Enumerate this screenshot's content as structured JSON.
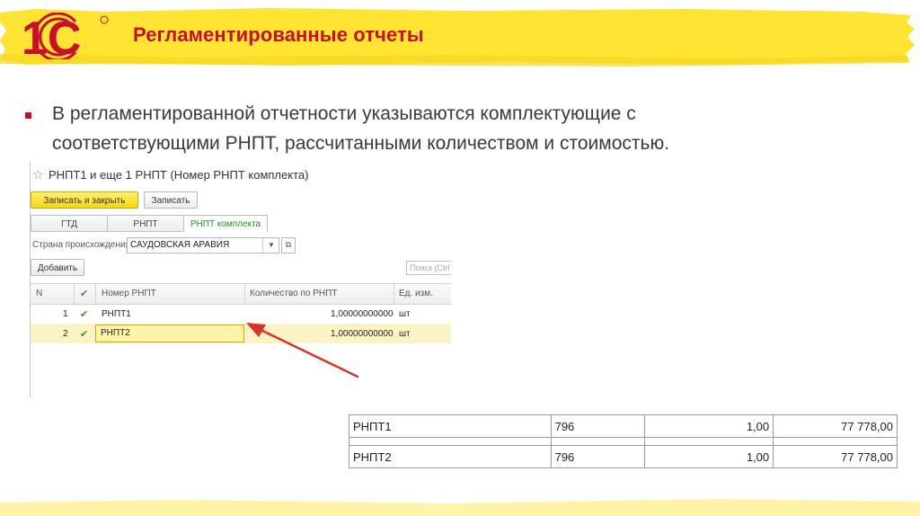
{
  "header": {
    "logo_text": "1С",
    "title": "Регламентированные отчеты",
    "colors": {
      "brand_red": "#c8102e",
      "band_yellow": "#ffe433"
    }
  },
  "bullet": {
    "line1": "В регламентированной отчетности указываются комплектующие с",
    "line2": "соответствующими РНПТ, рассчитанными количеством и стоимостью."
  },
  "form": {
    "title": "РНПТ1 и еще 1 РНПТ (Номер РНПТ комплекта)",
    "buttons": {
      "save_close": "Записать и закрыть",
      "save": "Записать",
      "add": "Добавить"
    },
    "tabs": [
      "ГТД",
      "РНПТ",
      "РНПТ комплекта"
    ],
    "active_tab": "РНПТ комплекта",
    "country_label": "Страна происхождения:",
    "country_value": "САУДОВСКАЯ АРАВИЯ",
    "search_placeholder": "Поиск (Ctrl",
    "grid": {
      "columns": [
        "N",
        "",
        "Номер РНПТ",
        "Количество по РНПТ",
        "Ед. изм."
      ],
      "rows": [
        {
          "n": "1",
          "name": "РНПТ1",
          "qty": "1,00000000000",
          "unit": "шт"
        },
        {
          "n": "2",
          "name": "РНПТ2",
          "qty": "1,00000000000",
          "unit": "шт"
        }
      ]
    }
  },
  "print_table": {
    "rows": [
      {
        "name": "РНПТ1",
        "code": "796",
        "qty": "1,00",
        "sum": "77 778,00"
      },
      {
        "name": "РНПТ2",
        "code": "796",
        "qty": "1,00",
        "sum": "77 778,00"
      }
    ]
  }
}
